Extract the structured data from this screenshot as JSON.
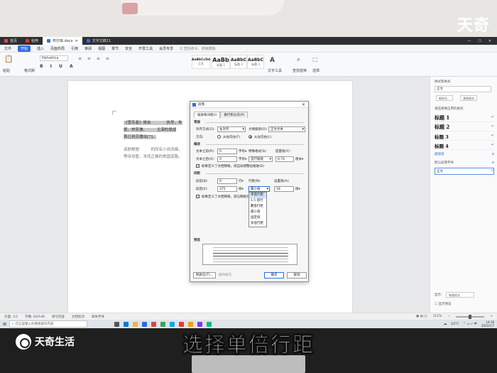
{
  "watermark": {
    "top_brand": "天奇",
    "bottom_brand": "天奇生活"
  },
  "caption": "选择单倍行距",
  "tabs": [
    {
      "label": "首页",
      "icon": "home-icon"
    },
    {
      "label": "稻壳",
      "icon": "docer-icon"
    },
    {
      "label": "布尔库.docx",
      "icon": "doc-icon",
      "active": true
    },
    {
      "label": "文字文稿11",
      "icon": "doc-icon"
    }
  ],
  "menu": [
    "文件",
    "开始",
    "插入",
    "页面布局",
    "引用",
    "审阅",
    "视图",
    "章节",
    "安全",
    "开发工具",
    "会员专享",
    "Q 查找命令、搜索模板"
  ],
  "ribbon": {
    "paste": "粘贴",
    "format_painter": "格式刷",
    "font": "Helvetica",
    "styles": [
      {
        "preview": "AaBbCcDd",
        "label": "正文"
      },
      {
        "preview": "AaBb",
        "label": "标题 1"
      },
      {
        "preview": "AaBbC",
        "label": "标题 2"
      },
      {
        "preview": "AaBbC",
        "label": "标题 3"
      }
    ],
    "text_tools": "文字工具",
    "find_replace": "查找替换",
    "select": "选择"
  },
  "document": {
    "para1_line1": "《雪花者》是由",
    "para1_line1b": "执导，朱",
    "para1_line2": "景、林安谦、",
    "para1_line2b": "主演的谍战",
    "para1_line3": "首已到京播出[7]。",
    "para2_line1": "该剧根据",
    "para2_line1b": "的同名小说改编，",
    "para2_line2": "等待攻堅，寻找正确的救国道路。"
  },
  "dialog": {
    "title": "段落",
    "tab_indent": "缩进和间距(I)",
    "tab_breaks": "换行和分页(P)",
    "section_general": "常规",
    "alignment_label": "对齐方式(G):",
    "alignment_value": "左对齐",
    "outline_label": "大纲级别(O):",
    "outline_value": "正文文本",
    "direction_label": "方向:",
    "rtl_label": "从右向左(F)",
    "ltr_label": "从左向右(L)",
    "section_indent": "缩进",
    "before_text_label": "文本之前(R):",
    "before_text_value": "0",
    "before_unit": "字符▾",
    "special_label": "特殊格式(S):",
    "measure_label": "度量值(Y):",
    "after_text_label": "文本之后(X):",
    "after_text_value": "0",
    "after_unit": "字符▾",
    "special_value": "首行缩进",
    "measure_value": "0.74",
    "measure_unit": "厘米▾",
    "grid_indent_check": "如果定义了文档网格，则自动调整右缩进(D)",
    "section_spacing": "间距",
    "before_label": "段前(B):",
    "before_value": "0",
    "before_spacing_unit": "行▾",
    "line_spacing_label": "行距(N):",
    "setting_label": "设置值(A):",
    "after_label": "段后(E):",
    "after_value": "375",
    "after_spacing_unit": "磅▾",
    "line_spacing_value": "最小值",
    "setting_value": "18",
    "setting_unit": "磅▾",
    "grid_align_check": "如果定义了文档网格，则与网格对齐(W)",
    "line_spacing_options": [
      "单倍行距",
      "1.5 倍行距",
      "2 倍行距",
      "最小值",
      "固定值",
      "多倍行距"
    ],
    "section_preview": "预览",
    "tabs_button": "制表位(T)...",
    "tips": "操作技巧",
    "ok": "确定",
    "cancel": "取消"
  },
  "pane": {
    "title": "样式和格式",
    "current": "正文",
    "new_style": "新样式...",
    "clear_format": "清除格式",
    "select_label": "请选择要应用的格式",
    "headings": [
      "标题 1",
      "标题 2",
      "标题 3",
      "标题 4"
    ],
    "hyperlink": "超链接",
    "default_font": "默认段落字体",
    "body": "正文",
    "show_label": "显示:",
    "show_value": "有效样式",
    "preview_check": "显示预览"
  },
  "status": {
    "page": "页面: 1/1",
    "words": "字数: 83/146",
    "spell": "拼写检查",
    "proof": "文档校对",
    "missing_font": "缺失字体",
    "zoom": "111%"
  },
  "taskbar": {
    "search_placeholder": "在这里输入你要搜索的内容",
    "temp": "10°C",
    "time": "14:38",
    "date": "2022/1/7"
  }
}
